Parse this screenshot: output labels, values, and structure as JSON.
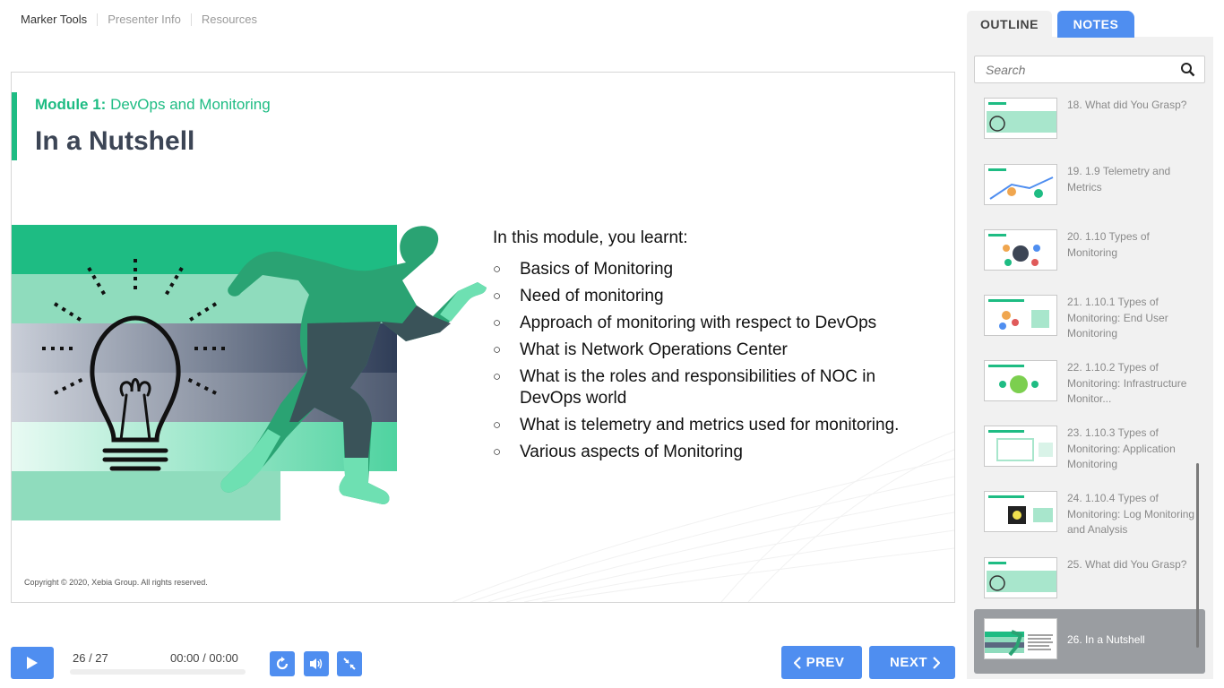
{
  "topnav": {
    "items": [
      "Marker Tools",
      "Presenter Info",
      "Resources"
    ]
  },
  "slide": {
    "module_prefix": "Module 1:",
    "module_name": "DevOps and Monitoring",
    "title": "In a Nutshell",
    "intro": "In this module, you learnt:",
    "bullets": [
      "Basics of Monitoring",
      "Need of monitoring",
      "Approach of monitoring with respect to DevOps",
      "What is Network Operations Center",
      "What is the roles and responsibilities of NOC in DevOps world",
      "What is telemetry and metrics used for monitoring.",
      "Various aspects of Monitoring"
    ],
    "copyright": "Copyright © 2020, Xebia Group. All rights reserved."
  },
  "player": {
    "counter": "26 / 27",
    "time": "00:00 / 00:00",
    "prev_label": "PREV",
    "next_label": "NEXT",
    "icons": [
      "play-icon",
      "replay-icon",
      "volume-icon",
      "collapse-icon",
      "chevron-left-icon",
      "chevron-right-icon"
    ]
  },
  "sidebar": {
    "tabs": [
      "OUTLINE",
      "NOTES"
    ],
    "active_tab": "NOTES",
    "search_placeholder": "Search",
    "items": [
      {
        "label": "18. What did You Grasp?"
      },
      {
        "label": "19. 1.9 Telemetry and Metrics"
      },
      {
        "label": "20. 1.10 Types of Monitoring"
      },
      {
        "label": "21. 1.10.1 Types of Monitoring: End User Monitoring"
      },
      {
        "label": "22. 1.10.2 Types of Monitoring: Infrastructure Monitor..."
      },
      {
        "label": "23. 1.10.3 Types of Monitoring: Application Monitoring"
      },
      {
        "label": "24. 1.10.4 Types of Monitoring: Log Monitoring and Analysis"
      },
      {
        "label": "25. What did You Grasp?"
      },
      {
        "label": "26. In a Nutshell",
        "active": true
      }
    ]
  },
  "colors": {
    "accent_green": "#1ebc83",
    "button_blue": "#4f8ef0",
    "title_dark": "#3c4555"
  }
}
